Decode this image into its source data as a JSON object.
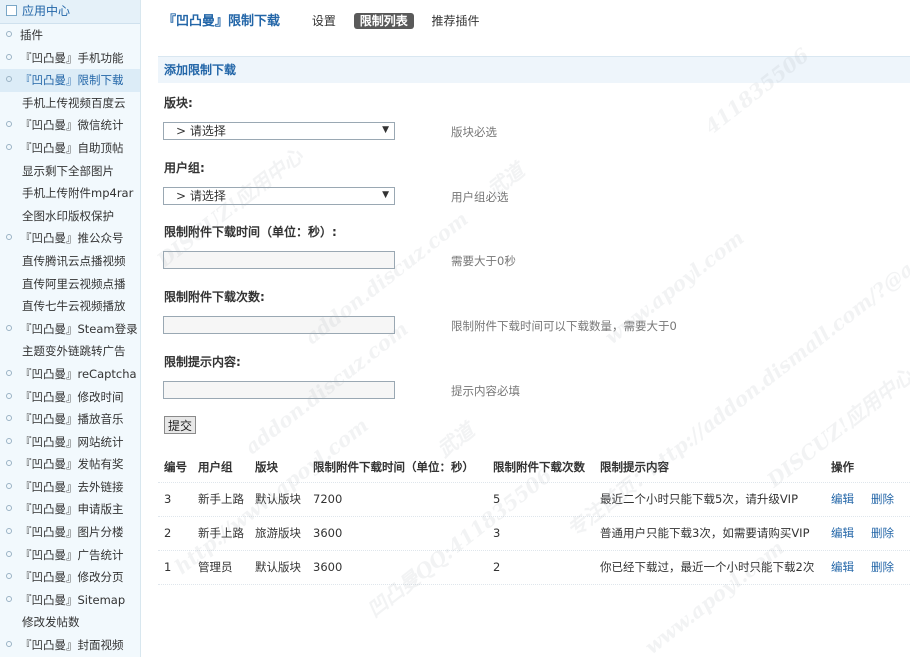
{
  "sidebar": {
    "header": "应用中心",
    "items": [
      {
        "label": "插件",
        "style": "dot"
      },
      {
        "label": "『凹凸曼』手机功能",
        "style": "dot"
      },
      {
        "label": "『凹凸曼』限制下载",
        "style": "dot",
        "active": true
      },
      {
        "label": "手机上传视频百度云",
        "style": "plain"
      },
      {
        "label": "『凹凸曼』微信统计",
        "style": "dot"
      },
      {
        "label": "『凹凸曼』自助顶帖",
        "style": "dot"
      },
      {
        "label": "显示剩下全部图片",
        "style": "plain"
      },
      {
        "label": "手机上传附件mp4rar",
        "style": "plain"
      },
      {
        "label": "全图水印版权保护",
        "style": "plain"
      },
      {
        "label": "『凹凸曼』推公众号",
        "style": "dot"
      },
      {
        "label": "直传腾讯云点播视频",
        "style": "plain"
      },
      {
        "label": "直传阿里云视频点播",
        "style": "plain"
      },
      {
        "label": "直传七牛云视频播放",
        "style": "plain"
      },
      {
        "label": "『凹凸曼』Steam登录",
        "style": "dot"
      },
      {
        "label": "主题变外链跳转广告",
        "style": "plain"
      },
      {
        "label": "『凹凸曼』reCaptcha",
        "style": "dot"
      },
      {
        "label": "『凹凸曼』修改时间",
        "style": "dot"
      },
      {
        "label": "『凹凸曼』播放音乐",
        "style": "dot"
      },
      {
        "label": "『凹凸曼』网站统计",
        "style": "dot"
      },
      {
        "label": "『凹凸曼』发帖有奖",
        "style": "dot"
      },
      {
        "label": "『凹凸曼』去外链接",
        "style": "dot"
      },
      {
        "label": "『凹凸曼』申请版主",
        "style": "dot"
      },
      {
        "label": "『凹凸曼』图片分楼",
        "style": "dot"
      },
      {
        "label": "『凹凸曼』广告统计",
        "style": "dot"
      },
      {
        "label": "『凹凸曼』修改分页",
        "style": "dot"
      },
      {
        "label": "『凹凸曼』Sitemap",
        "style": "dot"
      },
      {
        "label": "修改发帖数",
        "style": "plain"
      },
      {
        "label": "『凹凸曼』封面视频",
        "style": "dot"
      }
    ]
  },
  "topbar": {
    "title": "『凹凸曼』限制下载",
    "tabs": [
      "设置",
      "限制列表",
      "推荐插件"
    ],
    "active_tab": "限制列表"
  },
  "form": {
    "panel_title": "添加限制下载",
    "forum_label": "版块:",
    "forum_value": "> 请选择",
    "forum_hint": "版块必选",
    "group_label": "用户组:",
    "group_value": "> 请选择",
    "group_hint": "用户组必选",
    "time_label": "限制附件下载时间（单位：秒）:",
    "time_value": "",
    "time_hint": "需要大于0秒",
    "count_label": "限制附件下载次数:",
    "count_value": "",
    "count_hint": "限制附件下载时间可以下载数量，需要大于0",
    "msg_label": "限制提示内容:",
    "msg_value": "",
    "msg_hint": "提示内容必填",
    "submit_label": "提交"
  },
  "table": {
    "headers": [
      "编号",
      "用户组",
      "版块",
      "限制附件下载时间（单位：秒）",
      "限制附件下载次数",
      "限制提示内容",
      "操作",
      ""
    ],
    "rows": [
      {
        "id": "3",
        "group": "新手上路",
        "forum": "默认版块",
        "time": "7200",
        "count": "5",
        "msg": "最近二个小时只能下载5次，请升级VIP",
        "edit": "编辑",
        "del": "删除"
      },
      {
        "id": "2",
        "group": "新手上路",
        "forum": "旅游版块",
        "time": "3600",
        "count": "3",
        "msg": "普通用户只能下载3次，如需要请购买VIP",
        "edit": "编辑",
        "del": "删除"
      },
      {
        "id": "1",
        "group": "管理员",
        "forum": "默认版块",
        "time": "3600",
        "count": "2",
        "msg": "你已经下载过，最近一个小时只能下载2次",
        "edit": "编辑",
        "del": "删除"
      }
    ]
  },
  "watermark": [
    "DISCUZ!应用中心",
    "addon.discuz.com",
    "武道",
    "www.apoyl.com",
    "411835506",
    "http://www.apoyl.com",
    "凹凸曼QQ:411835506",
    "专注首页：http://addon.dismall.com/?@apoyl"
  ],
  "colors": {
    "accent": "#2366a8",
    "sidebar_bg": "#f2f9fd",
    "panel_bg": "#eef5fb"
  }
}
